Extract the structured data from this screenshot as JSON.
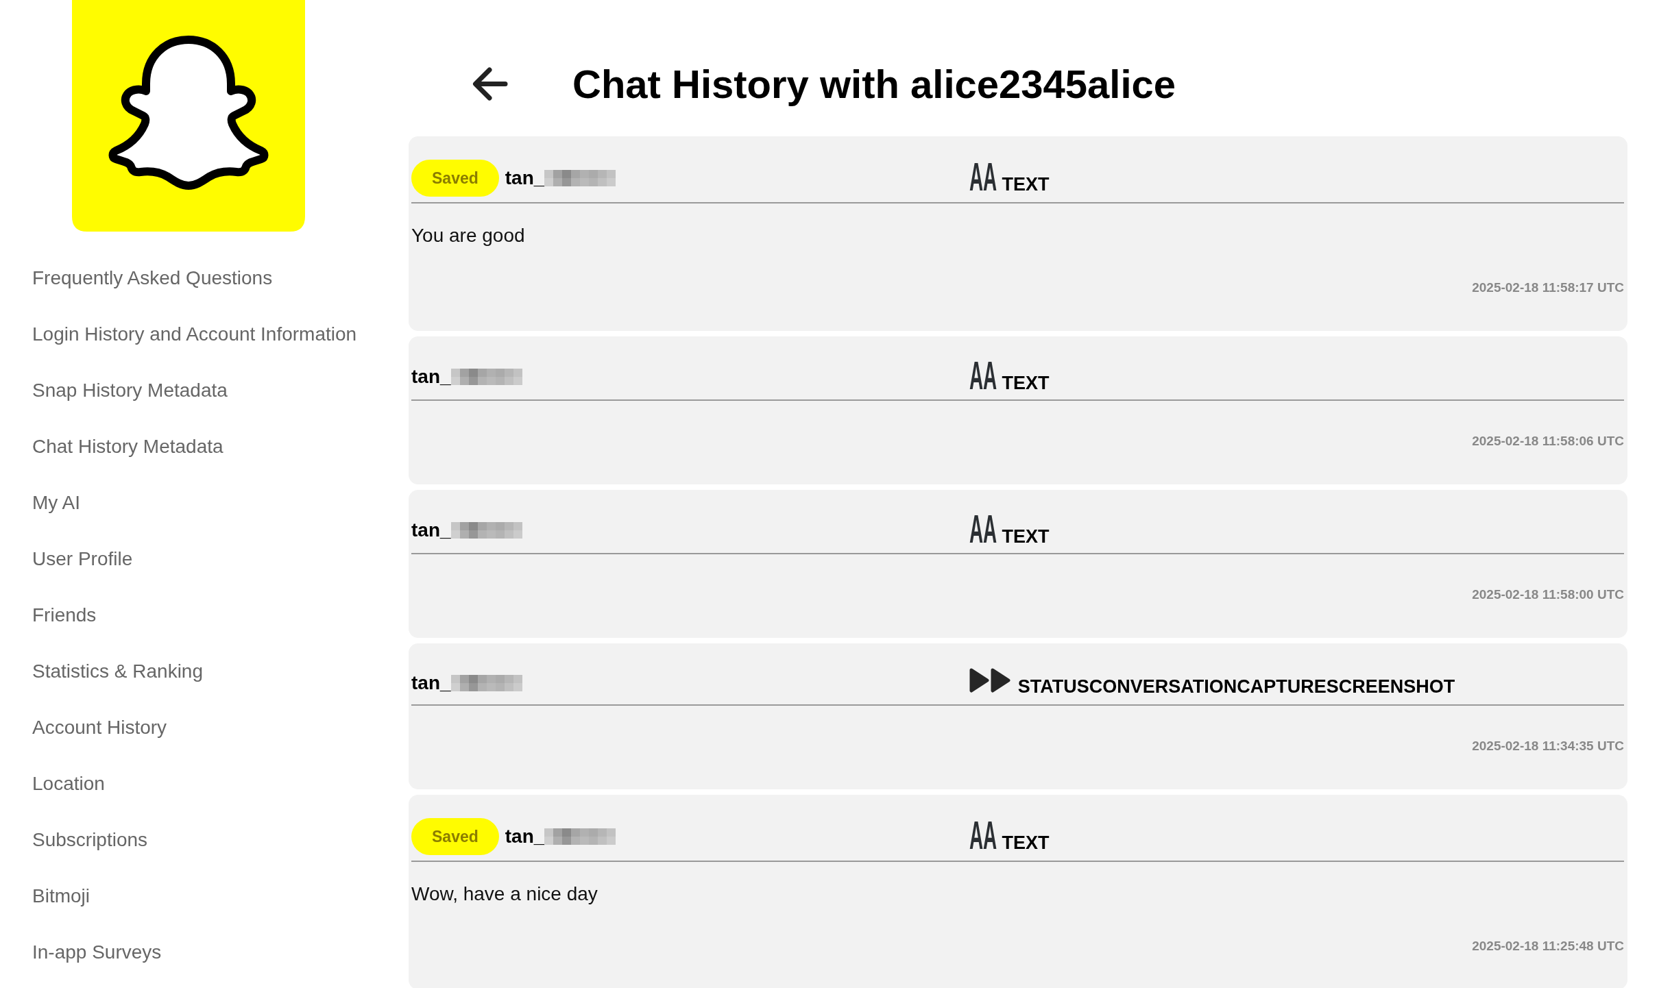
{
  "sidebar": {
    "items": [
      {
        "label": "Frequently Asked Questions",
        "selected": false
      },
      {
        "label": "Login History and Account Information",
        "selected": false
      },
      {
        "label": "Snap History Metadata",
        "selected": false
      },
      {
        "label": "Chat History Metadata",
        "selected": false
      },
      {
        "label": "My AI",
        "selected": false
      },
      {
        "label": "User Profile",
        "selected": false
      },
      {
        "label": "Friends",
        "selected": false
      },
      {
        "label": "Statistics & Ranking",
        "selected": false
      },
      {
        "label": "Account History",
        "selected": false
      },
      {
        "label": "Location",
        "selected": false
      },
      {
        "label": "Subscriptions",
        "selected": false
      },
      {
        "label": "Bitmoji",
        "selected": false
      },
      {
        "label": "In-app Surveys",
        "selected": false
      }
    ]
  },
  "header": {
    "title": "Chat History with alice2345alice"
  },
  "messages": [
    {
      "badge": "Saved",
      "sender": "tan_",
      "type": {
        "kind": "text",
        "icon": "AA",
        "label": "TEXT"
      },
      "body": "You are good",
      "timestamp": "2025-02-18 11:58:17 UTC"
    },
    {
      "sender": "tan_",
      "type": {
        "kind": "text",
        "icon": "AA",
        "label": "TEXT"
      },
      "timestamp": "2025-02-18 11:58:06 UTC"
    },
    {
      "sender": "tan_",
      "type": {
        "kind": "text",
        "icon": "AA",
        "label": "TEXT"
      },
      "timestamp": "2025-02-18 11:58:00 UTC"
    },
    {
      "sender": "tan_",
      "type": {
        "kind": "status",
        "label": "STATUSCONVERSATIONCAPTURESCREENSHOT"
      },
      "timestamp": "2025-02-18 11:34:35 UTC"
    },
    {
      "badge": "Saved",
      "sender": "tan_",
      "type": {
        "kind": "text",
        "icon": "AA",
        "label": "TEXT"
      },
      "body": "Wow, have a nice day",
      "timestamp": "2025-02-18 11:25:48 UTC"
    }
  ]
}
